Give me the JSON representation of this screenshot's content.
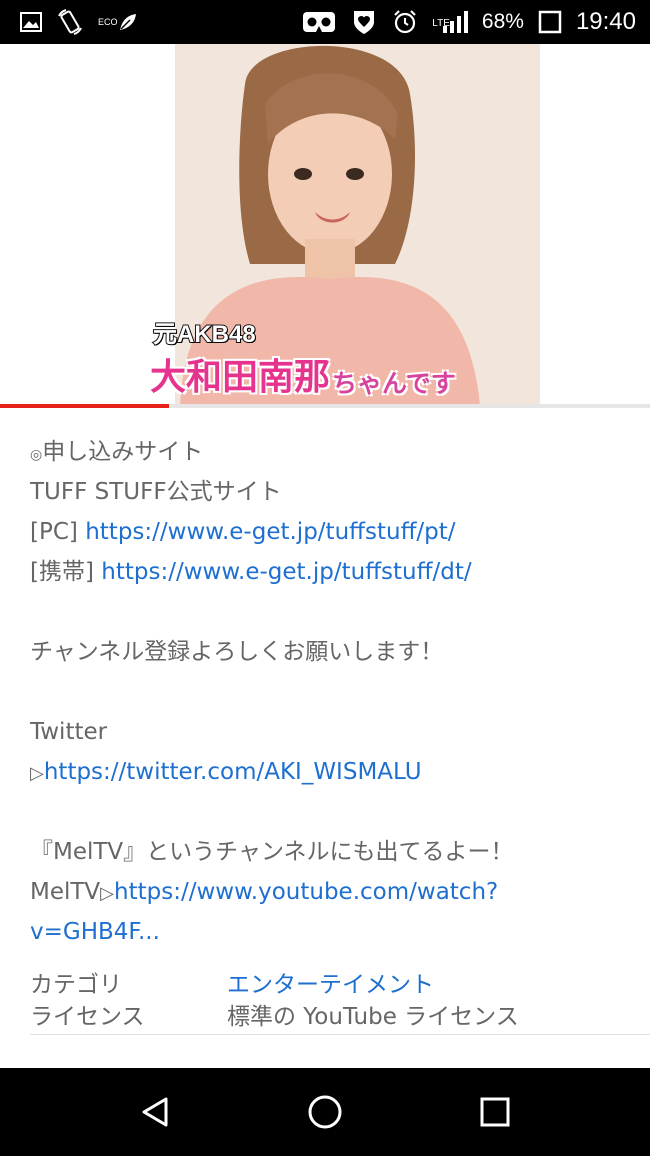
{
  "status_bar": {
    "eco_label": "ECO",
    "lte_label": "LTE",
    "battery": "68%",
    "time": "19:40",
    "icons": [
      "gallery-icon",
      "rotate-icon",
      "eco-leaf-icon",
      "vr-icon",
      "heart-shield-icon",
      "alarm-icon",
      "signal-icon",
      "battery-icon"
    ]
  },
  "video": {
    "caption_sub": "元AKB48",
    "caption_name": "大和田南那",
    "caption_suffix": "ちゃんです",
    "progress": 0.26,
    "progress_color": "#e62117"
  },
  "description": {
    "apply_heading": "申し込みサイト",
    "apply_bullet": "◎",
    "official_site": "TUFF STUFF公式サイト",
    "pc_prefix": "[PC]",
    "pc_url": "https://www.e-get.jp/tuffstuff/pt/",
    "mobile_prefix": "[携帯]",
    "mobile_url": "https://www.e-get.jp/tuffstuff/dt/",
    "subscribe": "チャンネル登録よろしくお願いします！",
    "twitter_label": "Twitter",
    "twitter_arrow": "▷",
    "twitter_url": "https://twitter.com/AKI_WISMALU",
    "meltv_note": "『MelTV』というチャンネルにも出てるよー！",
    "meltv_prefix": "MelTV",
    "meltv_arrow": "▷",
    "meltv_url_line1": "https://www.youtube.com/watch?",
    "meltv_url_line2": "v=GHB4F..."
  },
  "meta": {
    "category_key": "カテゴリ",
    "category_value": "エンターテイメント",
    "license_key": "ライセンス",
    "license_value": "標準の YouTube ライセンス"
  },
  "nav_bar": {
    "buttons": [
      "back-icon",
      "home-icon",
      "recents-icon"
    ]
  },
  "colors": {
    "link": "#1e6fd0",
    "text": "#666666",
    "caption_pink": "#e6348e"
  }
}
